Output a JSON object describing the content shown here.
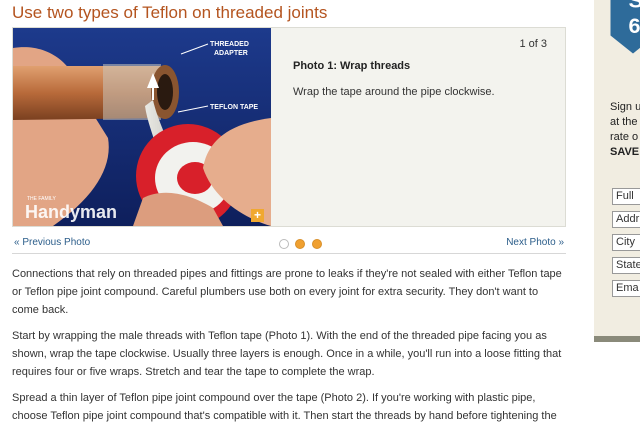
{
  "article": {
    "title": "Use two types of Teflon on threaded joints"
  },
  "slideshow": {
    "counter": "1 of 3",
    "caption_title": "Photo 1: Wrap threads",
    "caption_text": "Wrap the tape around the pipe clockwise.",
    "photo_labels": {
      "threaded_adapter_line1": "THREADED",
      "threaded_adapter_line2": "ADAPTER",
      "teflon_tape": "TEFLON TAPE",
      "brand_small": "THE FAMILY",
      "brand": "Handyman"
    },
    "expand_icon": "plus-icon",
    "prev_label": "« Previous Photo",
    "next_label": "Next Photo »",
    "dots": [
      "inactive",
      "active",
      "active"
    ]
  },
  "body": {
    "paragraphs": [
      "Connections that rely on threaded pipes and fittings are prone to leaks if they're not sealed with either Teflon tape or Teflon pipe joint compound. Careful plumbers use both on every joint for extra security. They don't want to come back.",
      "Start by wrapping the male threads with Teflon tape (Photo 1). With the end of the threaded pipe facing you as shown, wrap the tape clockwise. Usually three layers is enough. Once in a while, you'll run into a loose fitting that requires four or five wraps. Stretch and tear the tape to complete the wrap.",
      "Spread a thin layer of Teflon pipe joint compound over the tape (Photo 2). If you're working with plastic pipe, choose Teflon pipe joint compound that's compatible with it. Then start the threads by hand before tightening the"
    ]
  },
  "sidebar": {
    "badge_letters": [
      "S",
      "6"
    ],
    "promo_lines": [
      "Sign u",
      "at the",
      "rate o",
      "SAVE"
    ],
    "fields": [
      "Full",
      "Addr",
      "City",
      "State",
      "Ema"
    ]
  },
  "colors": {
    "title": "#b4541f",
    "link": "#2b5d8a",
    "dot_active": "#f0a030",
    "badge": "#2e6b9a",
    "sidebar_bg": "#f1ede1"
  }
}
